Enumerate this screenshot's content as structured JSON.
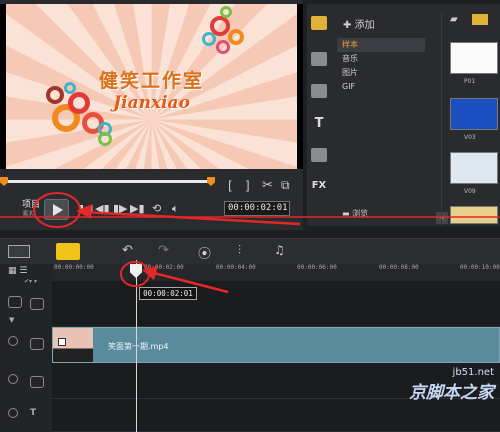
{
  "preview": {
    "title_cn": "健笑工作室",
    "subtitle": "Jianxiao",
    "mode_project": "项目",
    "mode_clip": "素材",
    "mark_in": "[",
    "mark_out": "]",
    "timecode": "00:00:02:01"
  },
  "library": {
    "add_label": "添加",
    "items": [
      "样本",
      "音乐",
      "图片",
      "GIF"
    ],
    "selected_index": 0,
    "browse_label": "浏览",
    "thumbnails": [
      "P01",
      "V03",
      "V09"
    ]
  },
  "timeline": {
    "tick_labels": [
      "00:00:00:00",
      "00:00:02:00",
      "00:00:04:00",
      "00:00:06:00",
      "00:00:08:00",
      "00:00:10:00"
    ],
    "playhead_time": "00:00:02:01",
    "clip_name": "笑面第一期.mp4"
  },
  "watermark": {
    "site": "jb51.net",
    "text": "京脚本之家"
  },
  "colors": {
    "accent": "#f28c1c",
    "annotation_red": "#e2282a",
    "clip_teal": "#5a8b9d"
  }
}
